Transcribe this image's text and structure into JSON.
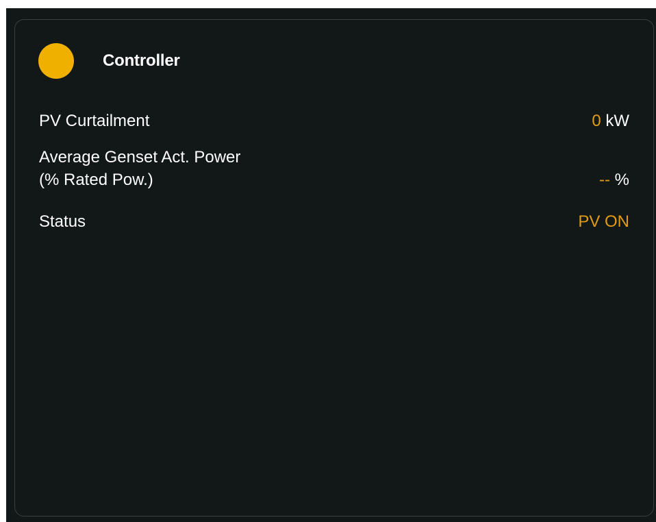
{
  "colors": {
    "background": "#121718",
    "border": "#3a4043",
    "text": "#ffffff",
    "accent": "#e39b14",
    "status_dot": "#f0b000"
  },
  "card": {
    "title": "Controller",
    "status_icon": "status-dot-icon",
    "rows": [
      {
        "label": "PV Curtailment",
        "value": "0",
        "unit": "kW"
      },
      {
        "label": "Average Genset Act. Power\n(% Rated Pow.)",
        "value": "--",
        "unit": "%"
      },
      {
        "label": "Status",
        "value": "PV ON",
        "unit": ""
      }
    ]
  }
}
